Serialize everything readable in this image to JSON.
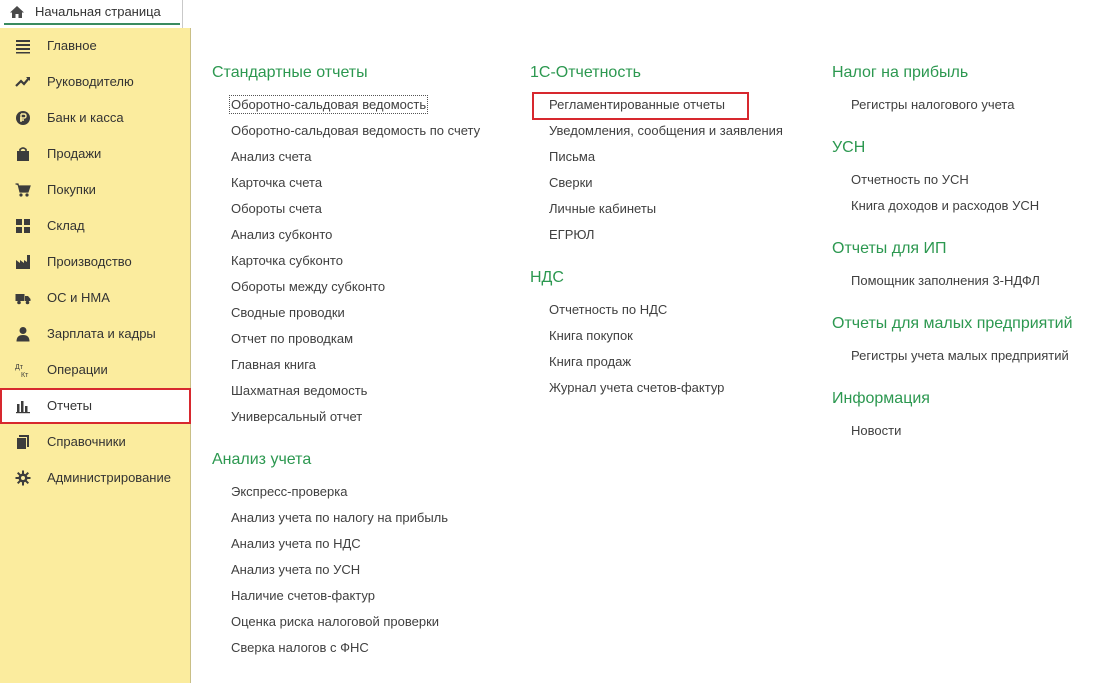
{
  "home_tab": {
    "label": "Начальная страница",
    "icon": "home-icon",
    "underline_color": "#3a8b5f"
  },
  "sidebar": {
    "background": "#fbec9e",
    "items": [
      {
        "label": "Главное",
        "icon": "menu-lines-icon"
      },
      {
        "label": "Руководителю",
        "icon": "trend-chart-icon"
      },
      {
        "label": "Банк и касса",
        "icon": "ruble-coin-icon"
      },
      {
        "label": "Продажи",
        "icon": "shopping-bag-icon"
      },
      {
        "label": "Покупки",
        "icon": "shopping-cart-icon"
      },
      {
        "label": "Склад",
        "icon": "warehouse-grid-icon"
      },
      {
        "label": "Производство",
        "icon": "factory-icon"
      },
      {
        "label": "ОС и НМА",
        "icon": "truck-icon"
      },
      {
        "label": "Зарплата и кадры",
        "icon": "person-icon"
      },
      {
        "label": "Операции",
        "icon": "debit-credit-icon",
        "icon_text_top": "Дт",
        "icon_text_bottom": "Кт"
      },
      {
        "label": "Отчеты",
        "icon": "bar-chart-icon",
        "active": true
      },
      {
        "label": "Справочники",
        "icon": "books-icon"
      },
      {
        "label": "Администрирование",
        "icon": "gear-icon"
      }
    ]
  },
  "columns": {
    "left": {
      "sections": [
        {
          "title": "Стандартные отчеты",
          "links": [
            "Оборотно-сальдовая ведомость",
            "Оборотно-сальдовая ведомость по счету",
            "Анализ счета",
            "Карточка счета",
            "Обороты счета",
            "Анализ субконто",
            "Карточка субконто",
            "Обороты между субконто",
            "Сводные проводки",
            "Отчет по проводкам",
            "Главная книга",
            "Шахматная ведомость",
            "Универсальный отчет"
          ]
        },
        {
          "title": "Анализ учета",
          "links": [
            "Экспресс-проверка",
            "Анализ учета по налогу на прибыль",
            "Анализ учета по НДС",
            "Анализ учета по УСН",
            "Наличие счетов-фактур",
            "Оценка риска налоговой проверки",
            "Сверка налогов с ФНС"
          ]
        }
      ]
    },
    "middle": {
      "sections": [
        {
          "title": "1С-Отчетность",
          "links": [
            "Регламентированные отчеты",
            "Уведомления, сообщения и заявления",
            "Письма",
            "Сверки",
            "Личные кабинеты",
            "ЕГРЮЛ"
          ]
        },
        {
          "title": "НДС",
          "links": [
            "Отчетность по НДС",
            "Книга покупок",
            "Книга продаж",
            "Журнал учета счетов-фактур"
          ]
        }
      ]
    },
    "right": {
      "sections": [
        {
          "title": "Налог на прибыль",
          "links": [
            "Регистры налогового учета"
          ]
        },
        {
          "title": "УСН",
          "links": [
            "Отчетность по УСН",
            "Книга доходов и расходов УСН"
          ]
        },
        {
          "title": "Отчеты для ИП",
          "links": [
            "Помощник заполнения 3-НДФЛ"
          ]
        },
        {
          "title": "Отчеты для малых предприятий",
          "links": [
            "Регистры учета малых предприятий"
          ]
        },
        {
          "title": "Информация",
          "links": [
            "Новости"
          ]
        }
      ]
    }
  },
  "colors": {
    "section_title": "#2c9850",
    "link_text": "#404040",
    "highlight": "#d7282e"
  }
}
